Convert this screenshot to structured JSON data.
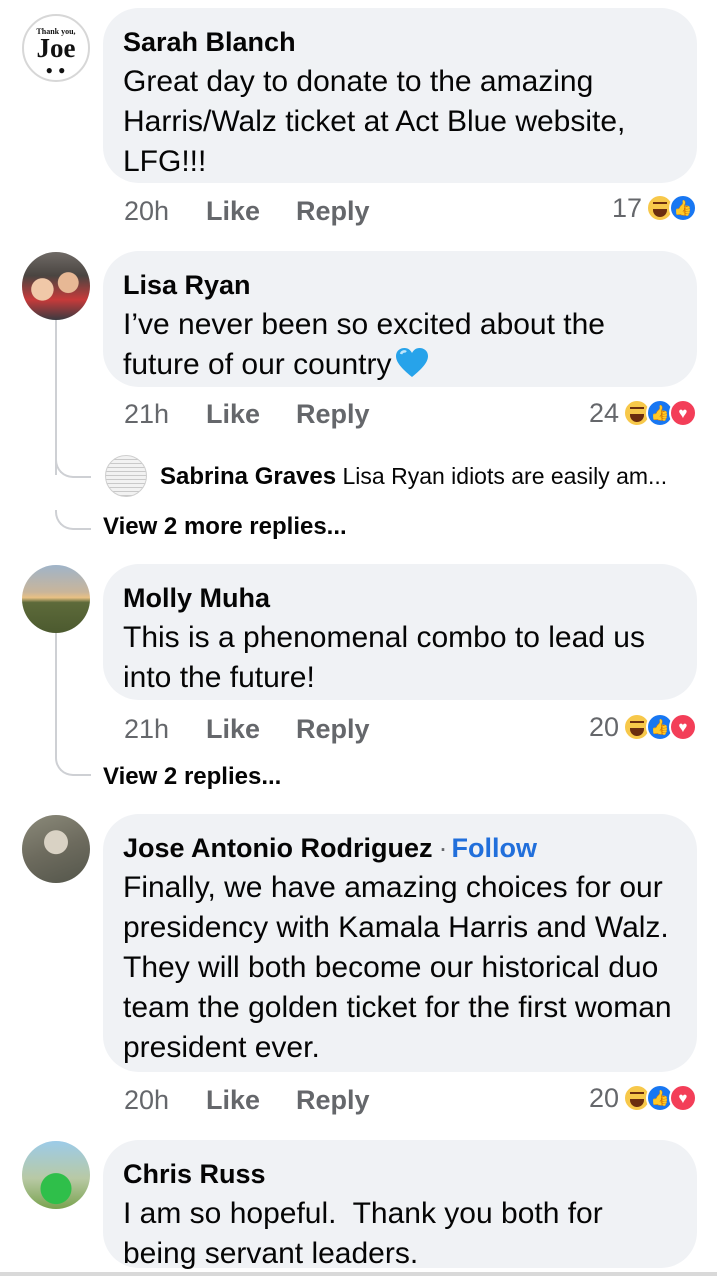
{
  "comments": [
    {
      "author": "Sarah Blanch",
      "text": "Great day to donate to the amazing Harris/Walz ticket at Act Blue website, LFG!!!",
      "time": "20h",
      "like": "Like",
      "reply": "Reply",
      "reaction_count": "17",
      "reactions": [
        "haha",
        "like"
      ],
      "avatar": {
        "small_text": "Thank you,",
        "big_text": "Joe"
      }
    },
    {
      "author": "Lisa Ryan",
      "text": "I’ve never been so excited about the future of our country",
      "emoji": "blue-heart",
      "time": "21h",
      "like": "Like",
      "reply": "Reply",
      "reaction_count": "24",
      "reactions": [
        "haha",
        "like",
        "love"
      ]
    },
    {
      "author": "Molly Muha",
      "text": "This is a phenomenal combo to lead us into the future!",
      "time": "21h",
      "like": "Like",
      "reply": "Reply",
      "reaction_count": "20",
      "reactions": [
        "haha",
        "like",
        "love"
      ]
    },
    {
      "author": "Jose Antonio Rodriguez",
      "follow": "Follow",
      "text": "Finally, we have amazing choices for our presidency with Kamala Harris and Walz. They will both become our historical duo team the golden ticket for the first woman president ever.",
      "time": "20h",
      "like": "Like",
      "reply": "Reply",
      "reaction_count": "20",
      "reactions": [
        "haha",
        "like",
        "love"
      ]
    },
    {
      "author": "Chris Russ",
      "text": "I am so hopeful.  Thank you both for being servant leaders."
    }
  ],
  "lisa_reply_preview": {
    "author": "Sabrina Graves",
    "text": "Lisa Ryan idiots are easily am..."
  },
  "lisa_more_replies": "View 2 more replies...",
  "molly_more_replies": "View 2 replies...",
  "colors": {
    "bubble": "#f0f2f5",
    "meta_text": "#65676b",
    "follow_link": "#216fdb",
    "like_blue": "#1877f2",
    "love_red": "#f33e58",
    "haha_yellow": "#f7c84a",
    "thread_line": "#ced0d4"
  }
}
